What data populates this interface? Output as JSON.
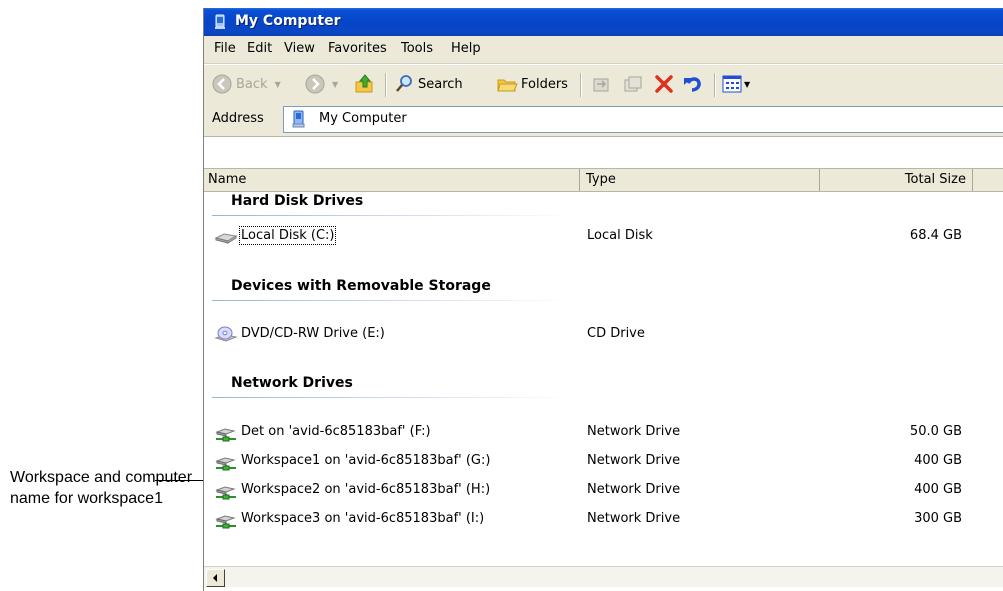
{
  "callout": {
    "text": "Workspace and computer name for workspace1"
  },
  "window": {
    "title": "My Computer"
  },
  "menu": [
    "File",
    "Edit",
    "View",
    "Favorites",
    "Tools",
    "Help"
  ],
  "toolbar": {
    "back": "Back",
    "search": "Search",
    "folders": "Folders"
  },
  "address": {
    "label": "Address",
    "value": "My Computer"
  },
  "columns": {
    "name": "Name",
    "type": "Type",
    "size": "Total Size"
  },
  "groups": {
    "hard": "Hard Disk Drives",
    "removable": "Devices with Removable Storage",
    "network": "Network Drives"
  },
  "rows": {
    "c": {
      "name": "Local Disk (C:)",
      "type": "Local Disk",
      "size": "68.4 GB"
    },
    "e": {
      "name": "DVD/CD-RW Drive (E:)",
      "type": "CD Drive",
      "size": ""
    },
    "f": {
      "name": "Det on 'avid-6c85183baf' (F:)",
      "type": "Network Drive",
      "size": "50.0 GB"
    },
    "g": {
      "name": "Workspace1 on 'avid-6c85183baf' (G:)",
      "type": "Network Drive",
      "size": "400 GB"
    },
    "h": {
      "name": "Workspace2 on 'avid-6c85183baf' (H:)",
      "type": "Network Drive",
      "size": "400 GB"
    },
    "i": {
      "name": "Workspace3 on 'avid-6c85183baf' (I:)",
      "type": "Network Drive",
      "size": "300 GB"
    }
  },
  "icons": {
    "title": "my-computer-icon",
    "hdd": "hard-disk-icon",
    "dvd": "dvd-drive-icon",
    "net": "network-drive-icon"
  },
  "colors": {
    "titlebar": "#0646c9",
    "chrome": "#ece9d8",
    "delete": "#e0301e"
  }
}
